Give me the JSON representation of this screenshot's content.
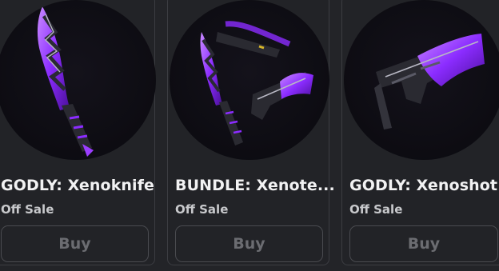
{
  "items": [
    {
      "name": "GODLY: Xenoknife",
      "price_status": "Off Sale",
      "buy_label": "Buy",
      "thumbnail_icon": "xenoknife-icon"
    },
    {
      "name": "BUNDLE: Xenote...",
      "price_status": "Off Sale",
      "buy_label": "Buy",
      "thumbnail_icon": "xenotech-bundle-icon"
    },
    {
      "name": "GODLY: Xenoshot",
      "price_status": "Off Sale",
      "buy_label": "Buy",
      "thumbnail_icon": "xenoshot-icon"
    }
  ],
  "colors": {
    "background": "#232428",
    "card_border": "#3c3d42",
    "accent_purple": "#8b2cff",
    "text_primary": "#f2f2f3",
    "text_secondary": "#c8c9cc",
    "button_text": "#6b6c71"
  }
}
